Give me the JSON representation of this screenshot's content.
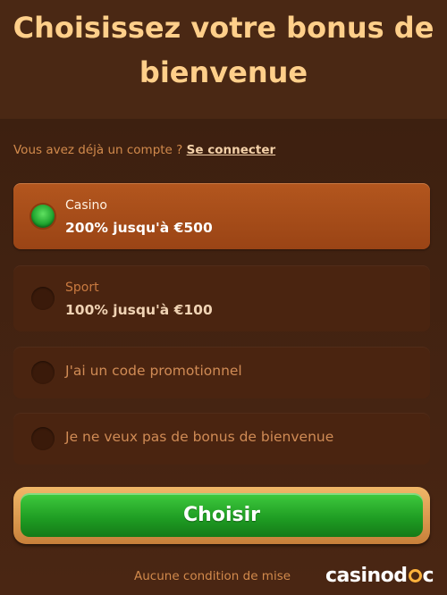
{
  "header": {
    "title": "Choisissez votre bonus de bienvenue"
  },
  "login": {
    "prompt": "Vous avez déjà un compte ?",
    "link": "Se connecter"
  },
  "options": [
    {
      "label": "Casino",
      "value": "200% jusqu'à €500",
      "selected": true
    },
    {
      "label": "Sport",
      "value": "100% jusqu'à €100",
      "selected": false
    },
    {
      "label": "J'ai un code promotionnel",
      "selected": false
    },
    {
      "label": "Je ne veux pas de bonus de bienvenue",
      "selected": false
    }
  ],
  "cta": {
    "label": "Choisir"
  },
  "footnote": "Aucune condition de mise",
  "logo": {
    "text": "casinodoc"
  },
  "colors": {
    "accent_green": "#1e9b22",
    "title": "#ffcf8a",
    "selected_bg": "#a94c19"
  }
}
